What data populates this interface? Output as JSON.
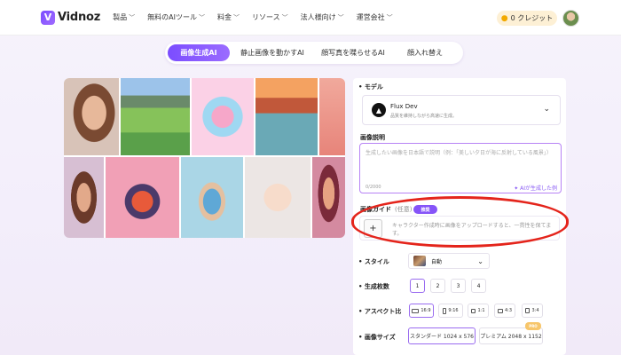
{
  "header": {
    "logo_text": "Vidnoz",
    "nav": [
      "製品",
      "無料のAIツール",
      "料金",
      "リソース",
      "法人様向け",
      "運営会社"
    ],
    "credits_label": "0 クレジット"
  },
  "tabs": [
    {
      "label": "画像生成AI",
      "active": true
    },
    {
      "label": "静止画像を動かすAI",
      "active": false
    },
    {
      "label": "顔写真を喋らせるAI",
      "active": false
    },
    {
      "label": "顔入れ替え",
      "active": false
    }
  ],
  "panel": {
    "model_label": "• モデル",
    "model_name": "Flux Dev",
    "model_desc": "品質を維持しながら高速に生成。",
    "desc_label": "画像説明",
    "desc_placeholder": "生成したい画像を日本語で説明（例：「美しい夕日が海に反射している風景」）",
    "desc_count": "0/2000",
    "desc_ai_link": "✦ AIが生成した例",
    "guide_label": "画像ガイド",
    "guide_optional": "(任意)",
    "guide_badge": "推奨",
    "guide_placeholder": "キャラクター作成時に画像をアップロードすると、一貫性を保てます。",
    "style_label": "• スタイル",
    "style_value": "自動",
    "count_label": "• 生成枚数",
    "counts": [
      "1",
      "2",
      "3",
      "4"
    ],
    "aspect_label": "• アスペクト比",
    "aspects": [
      "16:9",
      "9:16",
      "1:1",
      "4:3",
      "3:4"
    ],
    "size_label": "• 画像サイズ",
    "sizes": [
      "スタンダード 1024 x 576",
      "プレミアム 2048 x 1152"
    ],
    "pro_badge": "PRO"
  },
  "colors": {
    "accent": "#8654f8",
    "highlight": "#e4241b"
  }
}
